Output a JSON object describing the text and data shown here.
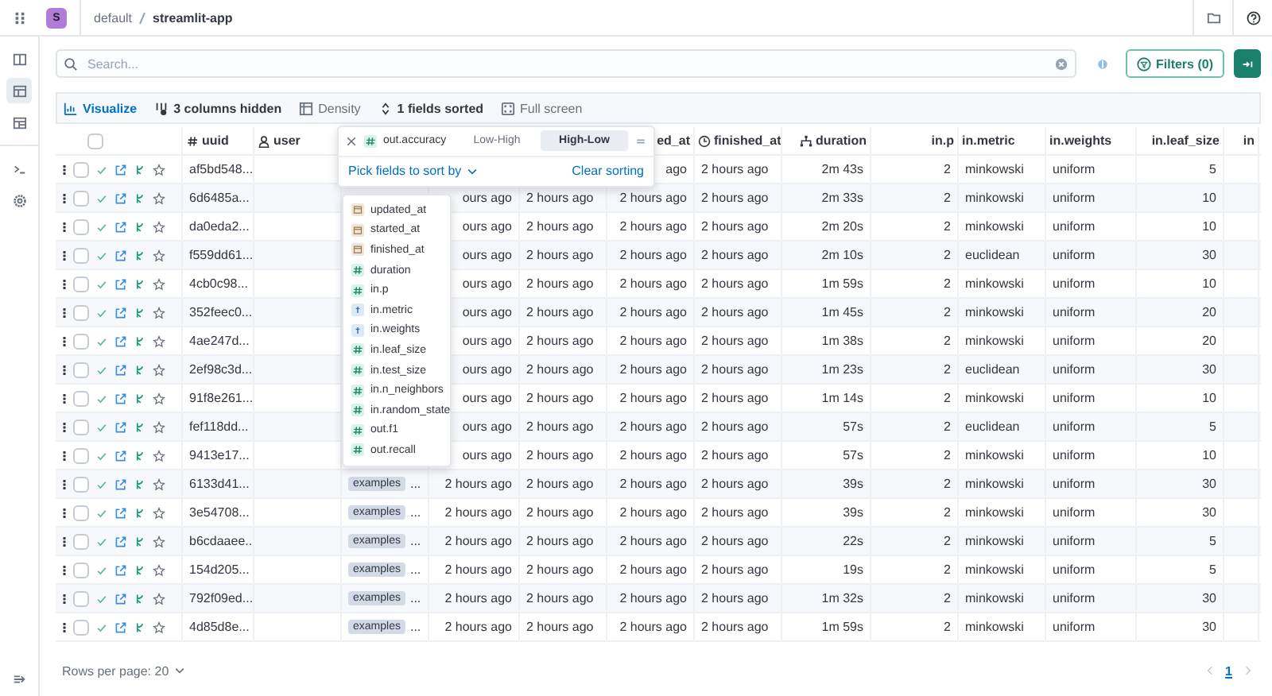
{
  "topbar": {
    "avatar": "S",
    "breadcrumb": [
      {
        "label": "default",
        "selected": false
      },
      {
        "label": "streamlit-app",
        "selected": true
      }
    ]
  },
  "sidebar": {
    "items": [
      {
        "kind": "panels",
        "selected": false
      },
      {
        "kind": "table",
        "selected": true
      },
      {
        "kind": "dashboard",
        "selected": false
      },
      {
        "kind": "terminal",
        "selected": false
      },
      {
        "kind": "settings",
        "selected": false
      }
    ]
  },
  "search": {
    "placeholder": "Search..."
  },
  "filters_button": "Filters (0)",
  "toolbar": [
    {
      "kind": "visualize",
      "label": "Visualize"
    },
    {
      "kind": "columns",
      "label": "3 columns hidden"
    },
    {
      "kind": "density",
      "label": "Density"
    },
    {
      "kind": "sort",
      "label": "1 fields sorted"
    },
    {
      "kind": "fullscreen",
      "label": "Full screen"
    }
  ],
  "table": {
    "all_checked": false,
    "columns": [
      {
        "label": "uuid",
        "kind": "id"
      },
      {
        "label": "user",
        "kind": "user"
      },
      {
        "kind": "tags"
      },
      {
        "kind": "time"
      },
      {
        "kind": "time"
      },
      {
        "label": "ed_at",
        "kind": "time"
      },
      {
        "label": "finished_at",
        "kind": "time"
      },
      {
        "label": "duration",
        "kind": "duration"
      },
      {
        "label": "in.p",
        "kind": "number"
      },
      {
        "label": "in.metric",
        "kind": "text"
      },
      {
        "label": "in.weights",
        "kind": "text"
      },
      {
        "label": "in.leaf_size",
        "kind": "number"
      },
      {
        "label": "in",
        "kind": "number"
      }
    ],
    "rows": [
      {
        "checked": false,
        "starred": false,
        "cells": [
          "af5bd548...",
          null,
          null,
          null,
          null,
          "ago",
          "2 hours ago",
          "2m 43s",
          "2",
          "minkowski",
          "uniform",
          "5",
          null
        ]
      },
      {
        "checked": false,
        "starred": false,
        "cells": [
          "6d6485a...",
          null,
          null,
          "ours ago",
          "2 hours ago",
          "2 hours ago",
          "2 hours ago",
          "2m 33s",
          "2",
          "minkowski",
          "uniform",
          "10",
          null
        ]
      },
      {
        "checked": false,
        "starred": false,
        "cells": [
          "da0eda2...",
          null,
          null,
          "ours ago",
          "2 hours ago",
          "2 hours ago",
          "2 hours ago",
          "2m 20s",
          "2",
          "minkowski",
          "uniform",
          "10",
          null
        ]
      },
      {
        "checked": false,
        "starred": false,
        "cells": [
          "f559dd61...",
          null,
          null,
          "ours ago",
          "2 hours ago",
          "2 hours ago",
          "2 hours ago",
          "2m 10s",
          "2",
          "euclidean",
          "uniform",
          "30",
          null
        ]
      },
      {
        "checked": false,
        "starred": false,
        "cells": [
          "4cb0c98...",
          null,
          null,
          "ours ago",
          "2 hours ago",
          "2 hours ago",
          "2 hours ago",
          "1m 59s",
          "2",
          "minkowski",
          "uniform",
          "10",
          null
        ]
      },
      {
        "checked": false,
        "starred": false,
        "cells": [
          "352feec0...",
          null,
          null,
          "ours ago",
          "2 hours ago",
          "2 hours ago",
          "2 hours ago",
          "1m 45s",
          "2",
          "minkowski",
          "uniform",
          "20",
          null
        ]
      },
      {
        "checked": false,
        "starred": false,
        "cells": [
          "4ae247d...",
          null,
          null,
          "ours ago",
          "2 hours ago",
          "2 hours ago",
          "2 hours ago",
          "1m 38s",
          "2",
          "minkowski",
          "uniform",
          "20",
          null
        ]
      },
      {
        "checked": false,
        "starred": false,
        "cells": [
          "2ef98c3d...",
          null,
          null,
          "ours ago",
          "2 hours ago",
          "2 hours ago",
          "2 hours ago",
          "1m 23s",
          "2",
          "euclidean",
          "uniform",
          "30",
          null
        ]
      },
      {
        "checked": false,
        "starred": false,
        "cells": [
          "91f8e261...",
          null,
          null,
          "ours ago",
          "2 hours ago",
          "2 hours ago",
          "2 hours ago",
          "1m 14s",
          "2",
          "minkowski",
          "uniform",
          "10",
          null
        ]
      },
      {
        "checked": false,
        "starred": false,
        "cells": [
          "fef118dd...",
          null,
          null,
          "ours ago",
          "2 hours ago",
          "2 hours ago",
          "2 hours ago",
          "57s",
          "2",
          "euclidean",
          "uniform",
          "5",
          null
        ]
      },
      {
        "checked": false,
        "starred": false,
        "cells": [
          "9413e17...",
          null,
          null,
          "ours ago",
          "2 hours ago",
          "2 hours ago",
          "2 hours ago",
          "57s",
          "2",
          "minkowski",
          "uniform",
          "10",
          null
        ]
      },
      {
        "checked": false,
        "starred": false,
        "cells": [
          "6133d41...",
          null,
          {
            "chip": "examples",
            "more": "..."
          },
          "2 hours ago",
          "2 hours ago",
          "2 hours ago",
          "2 hours ago",
          "39s",
          "2",
          "minkowski",
          "uniform",
          "30",
          null
        ]
      },
      {
        "checked": false,
        "starred": false,
        "cells": [
          "3e54708...",
          null,
          {
            "chip": "examples",
            "more": "..."
          },
          "2 hours ago",
          "2 hours ago",
          "2 hours ago",
          "2 hours ago",
          "39s",
          "2",
          "minkowski",
          "uniform",
          "30",
          null
        ]
      },
      {
        "checked": false,
        "starred": false,
        "cells": [
          "b6cdaaee...",
          null,
          {
            "chip": "examples",
            "more": "..."
          },
          "2 hours ago",
          "2 hours ago",
          "2 hours ago",
          "2 hours ago",
          "22s",
          "2",
          "minkowski",
          "uniform",
          "5",
          null
        ]
      },
      {
        "checked": false,
        "starred": false,
        "cells": [
          "154d205...",
          null,
          {
            "chip": "examples",
            "more": "..."
          },
          "2 hours ago",
          "2 hours ago",
          "2 hours ago",
          "2 hours ago",
          "19s",
          "2",
          "minkowski",
          "uniform",
          "5",
          null
        ]
      },
      {
        "checked": false,
        "starred": false,
        "cells": [
          "792f09ed...",
          null,
          {
            "chip": "examples",
            "more": "..."
          },
          "2 hours ago",
          "2 hours ago",
          "2 hours ago",
          "2 hours ago",
          "1m 32s",
          "2",
          "minkowski",
          "uniform",
          "30",
          null
        ]
      },
      {
        "checked": false,
        "starred": false,
        "cells": [
          "4d85d8e...",
          null,
          {
            "chip": "examples",
            "more": "..."
          },
          "2 hours ago",
          "2 hours ago",
          "2 hours ago",
          "2 hours ago",
          "1m 59s",
          "2",
          "minkowski",
          "uniform",
          "30",
          null
        ]
      }
    ]
  },
  "sort_popover": {
    "field": "out.accuracy",
    "options": [
      {
        "label": "Low-High",
        "selected": false
      },
      {
        "label": "High-Low",
        "selected": true
      }
    ],
    "pick_label": "Pick fields to sort by",
    "clear_label": "Clear sorting"
  },
  "field_menu": [
    {
      "label": "updated_at",
      "kind": "date"
    },
    {
      "label": "started_at",
      "kind": "date"
    },
    {
      "label": "finished_at",
      "kind": "date"
    },
    {
      "label": "duration",
      "kind": "number"
    },
    {
      "label": "in.p",
      "kind": "number"
    },
    {
      "label": "in.metric",
      "kind": "text"
    },
    {
      "label": "in.weights",
      "kind": "text"
    },
    {
      "label": "in.leaf_size",
      "kind": "number"
    },
    {
      "label": "in.test_size",
      "kind": "number"
    },
    {
      "label": "in.n_neighbors",
      "kind": "number"
    },
    {
      "label": "in.random_state",
      "kind": "number"
    },
    {
      "label": "out.f1",
      "kind": "number"
    },
    {
      "label": "out.recall",
      "kind": "number"
    }
  ],
  "footer": {
    "rows_per_page": "Rows per page: 20",
    "pages": [
      {
        "label": "1",
        "selected": true
      }
    ]
  }
}
